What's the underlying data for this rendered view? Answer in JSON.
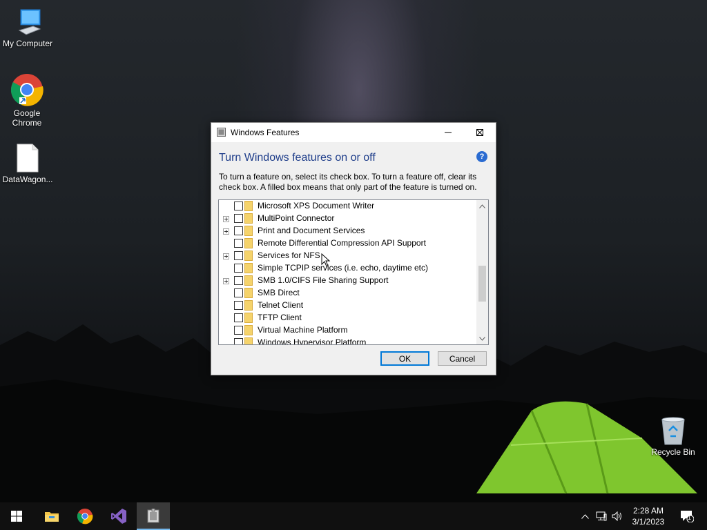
{
  "desktop": {
    "icons": [
      {
        "label": "My Computer"
      },
      {
        "label": "Google Chrome"
      },
      {
        "label": "DataWagon..."
      },
      {
        "label": "Recycle Bin"
      }
    ]
  },
  "window": {
    "title": "Windows Features",
    "heading": "Turn Windows features on or off",
    "help_label": "?",
    "description": "To turn a feature on, select its check box. To turn a feature off, clear its check box. A filled box means that only part of the feature is turned on.",
    "features": [
      {
        "label": "Microsoft XPS Document Writer",
        "expandable": false,
        "checked": false
      },
      {
        "label": "MultiPoint Connector",
        "expandable": true,
        "checked": false
      },
      {
        "label": "Print and Document Services",
        "expandable": true,
        "checked": false
      },
      {
        "label": "Remote Differential Compression API Support",
        "expandable": false,
        "checked": false
      },
      {
        "label": "Services for NFS",
        "expandable": true,
        "checked": false
      },
      {
        "label": "Simple TCPIP services (i.e. echo, daytime etc)",
        "expandable": false,
        "checked": false
      },
      {
        "label": "SMB 1.0/CIFS File Sharing Support",
        "expandable": true,
        "checked": false
      },
      {
        "label": "SMB Direct",
        "expandable": false,
        "checked": false
      },
      {
        "label": "Telnet Client",
        "expandable": false,
        "checked": false
      },
      {
        "label": "TFTP Client",
        "expandable": false,
        "checked": false
      },
      {
        "label": "Virtual Machine Platform",
        "expandable": false,
        "checked": false
      },
      {
        "label": "Windows Hypervisor Platform",
        "expandable": false,
        "checked": false
      }
    ],
    "ok_label": "OK",
    "cancel_label": "Cancel"
  },
  "taskbar": {
    "time": "2:28 AM",
    "date": "3/1/2023",
    "notification_count": "1"
  },
  "colors": {
    "heading": "#1e3d8a",
    "accent": "#0078d7",
    "taskbar": "#101010"
  }
}
